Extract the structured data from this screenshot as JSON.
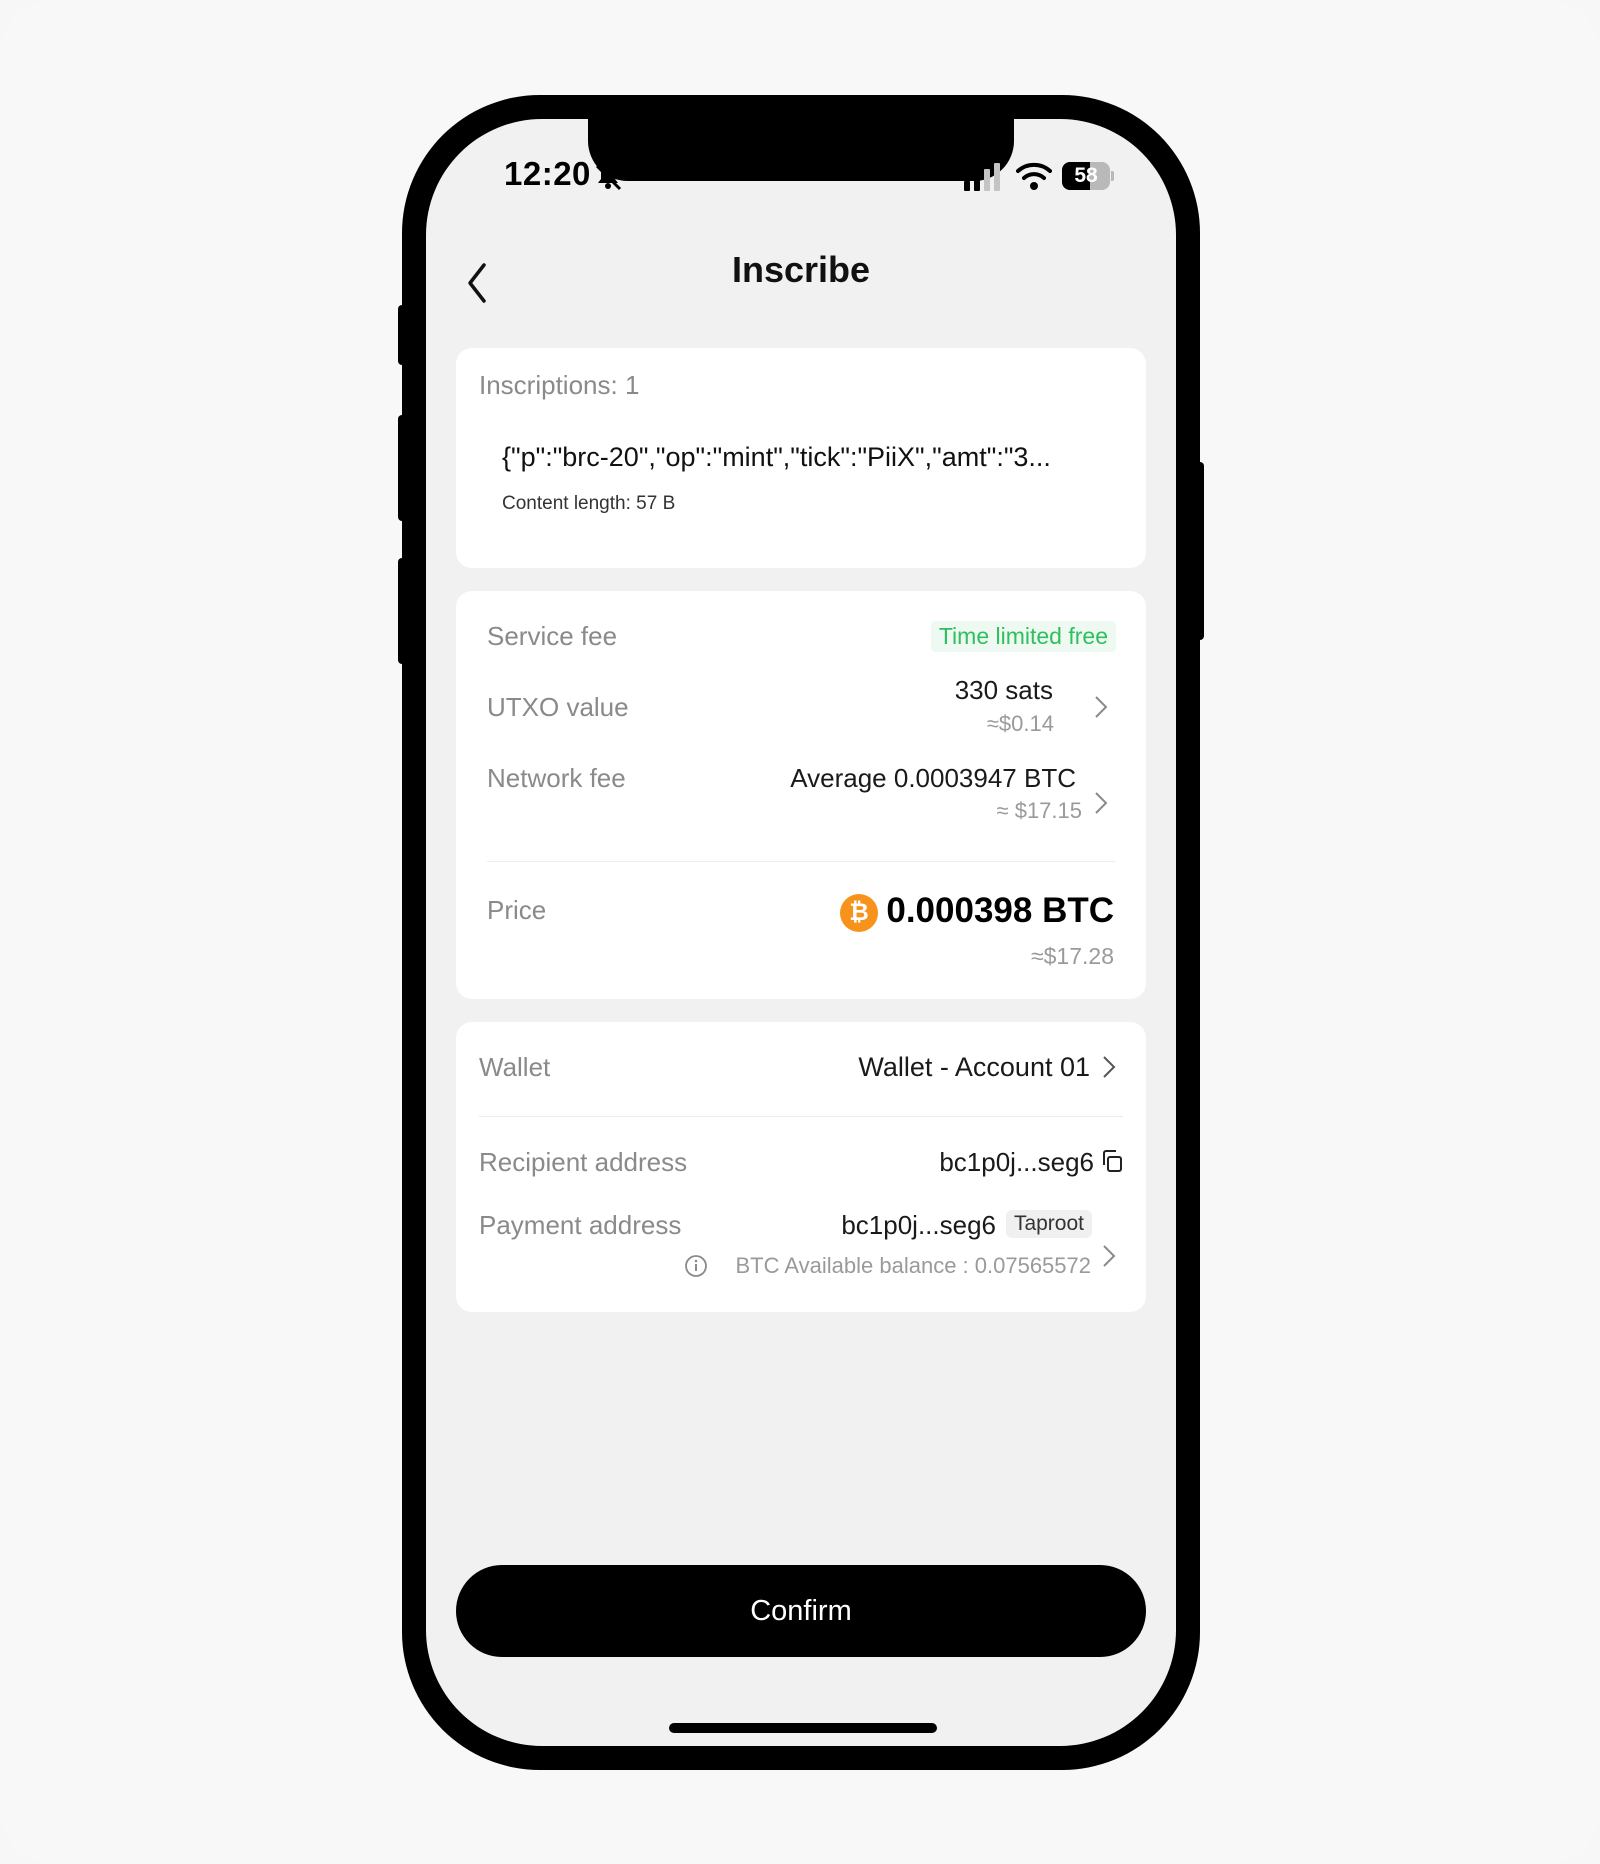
{
  "status_bar": {
    "time": "12:20",
    "battery_percent": "58",
    "battery_level": 0.58
  },
  "header": {
    "title": "Inscribe"
  },
  "inscription_card": {
    "count_label": "Inscriptions: 1",
    "content": "{\"p\":\"brc-20\",\"op\":\"mint\",\"tick\":\"PiiX\",\"amt\":\"3...",
    "content_length": "Content length: 57 B"
  },
  "fees": {
    "service_fee_label": "Service fee",
    "service_fee_badge": "Time limited free",
    "utxo_label": "UTXO value",
    "utxo_value": "330 sats",
    "utxo_usd": "≈$0.14",
    "network_label": "Network fee",
    "network_value": "Average 0.0003947 BTC",
    "network_usd": "≈ $17.15",
    "price_label": "Price",
    "price_value": "0.000398 BTC",
    "price_usd": "≈$17.28",
    "coin_symbol": "₿"
  },
  "wallet": {
    "wallet_label": "Wallet",
    "wallet_value": "Wallet - Account 01",
    "recipient_label": "Recipient address",
    "recipient_value": "bc1p0j...seg6",
    "payment_label": "Payment address",
    "payment_value": "bc1p0j...seg6",
    "payment_tag": "Taproot",
    "balance_text": "BTC Available balance : 0.07565572"
  },
  "actions": {
    "confirm_label": "Confirm"
  },
  "colors": {
    "accent_green": "#2fbf5e",
    "btc_orange": "#f7931a",
    "button_black": "#000000"
  }
}
